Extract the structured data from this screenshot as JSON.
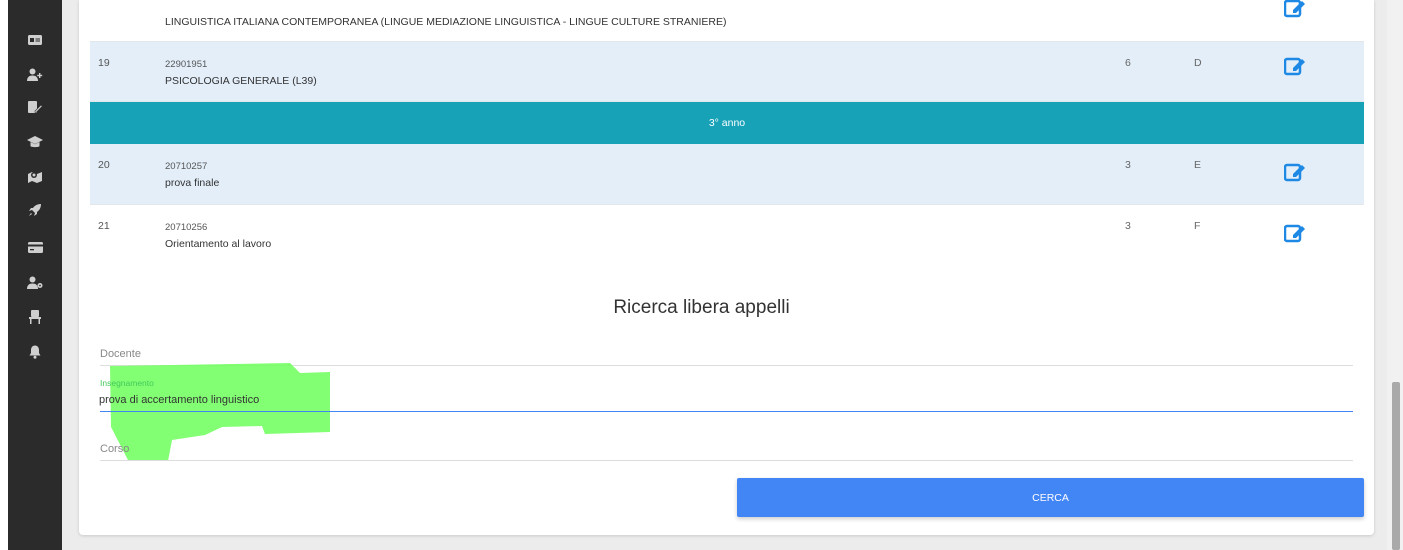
{
  "sidebar": {
    "items": [
      {
        "icon": "id-card-icon"
      },
      {
        "icon": "user-plus-icon"
      },
      {
        "icon": "file-edit-icon"
      },
      {
        "icon": "graduation-cap-icon"
      },
      {
        "icon": "map-location-icon"
      },
      {
        "icon": "rocket-icon"
      },
      {
        "icon": "credit-card-icon"
      },
      {
        "icon": "user-cog-icon"
      },
      {
        "icon": "chair-icon"
      },
      {
        "icon": "bell-icon"
      }
    ]
  },
  "exams": {
    "partial_row": {
      "title": "LINGUISTICA ITALIANA CONTEMPORANEA (LINGUE MEDIAZIONE LINGUISTICA - LINGUE CULTURE STRANIERE)"
    },
    "rows": [
      {
        "num": "19",
        "code": "22901951",
        "title": "PSICOLOGIA GENERALE (L39)",
        "cfu": "6",
        "type": "D"
      },
      {
        "num": "20",
        "code": "20710257",
        "title": "prova finale",
        "cfu": "3",
        "type": "E"
      },
      {
        "num": "21",
        "code": "20710256",
        "title": "Orientamento al lavoro",
        "cfu": "3",
        "type": "F"
      }
    ],
    "year_label": "3° anno"
  },
  "search": {
    "title": "Ricerca libera appelli",
    "docente_label": "Docente",
    "insegnamento_label": "Insegnamento",
    "insegnamento_value": "prova di accertamento linguistico",
    "corso_label": "Corso",
    "button_label": "CERCA"
  },
  "colors": {
    "accent_teal": "#17a2b8",
    "button_blue": "#4285f4",
    "input_focus": "#4285f4",
    "row_shaded": "#e3eef9",
    "sidebar_bg": "#2b2b2b",
    "highlight_green": "#6cff5a"
  }
}
